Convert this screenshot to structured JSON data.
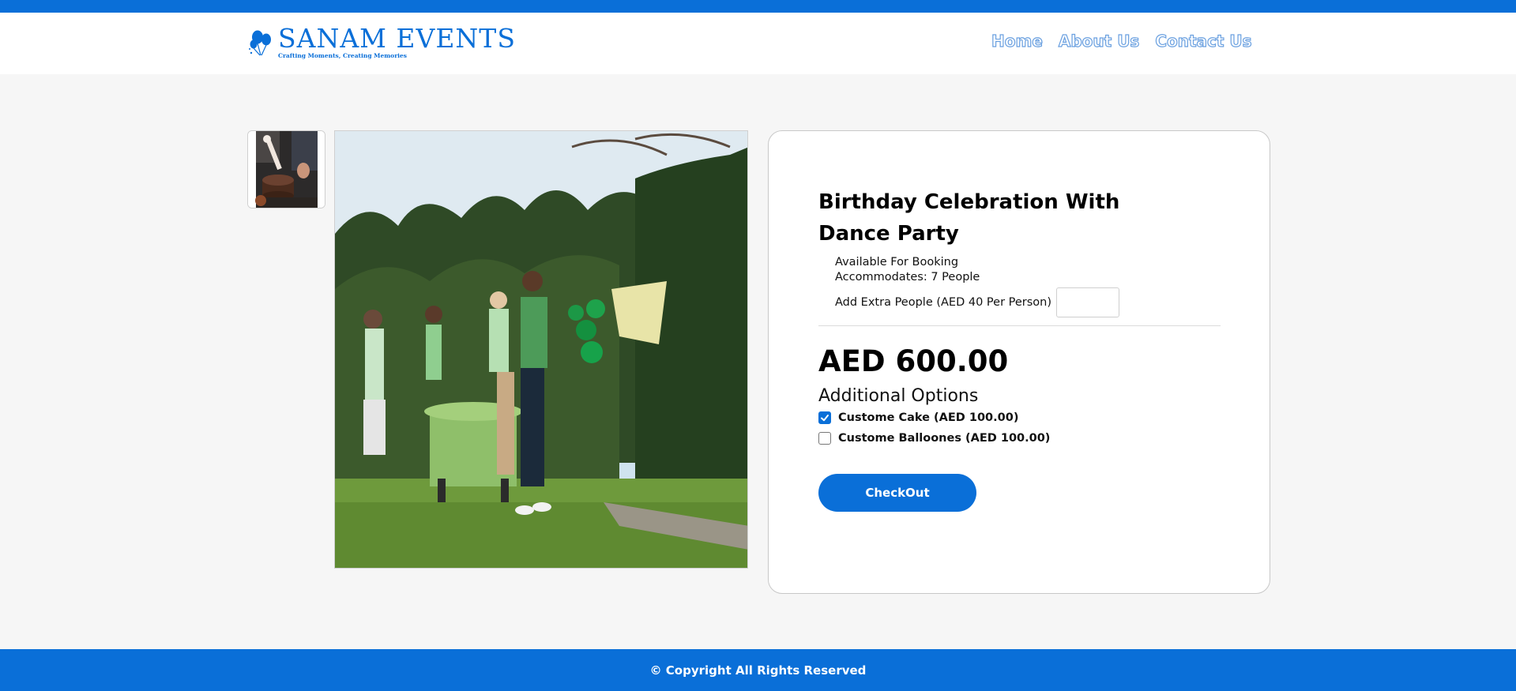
{
  "header": {
    "brand_name": "SANAM EVENTS",
    "brand_tagline": "Crafting Moments, Creating Memories",
    "nav": [
      {
        "label": "Home"
      },
      {
        "label": "About Us"
      },
      {
        "label": "Contact Us"
      }
    ]
  },
  "gallery": {
    "thumbnail_icon": "cake-photo-icon",
    "main_icon": "birthday-party-photo"
  },
  "product": {
    "title": "Birthday Celebration With Dance Party",
    "availability": "Available For Booking",
    "capacity": "Accommodates: 7 People",
    "extra_people_label": "Add Extra People (AED 40 Per Person)",
    "extra_people_value": "",
    "price": "AED 600.00",
    "additional_options_heading": "Additional Options",
    "options": [
      {
        "label": "Custome Cake (AED 100.00)",
        "checked": true
      },
      {
        "label": "Custome Balloones (AED 100.00)",
        "checked": false
      }
    ],
    "checkout_label": "CheckOut"
  },
  "footer": {
    "copyright": "© Copyright All Rights Reserved"
  },
  "colors": {
    "brand_blue": "#0a6fd8",
    "page_bg": "#f6f6f6",
    "nav_outline": "#6aa0e0"
  }
}
